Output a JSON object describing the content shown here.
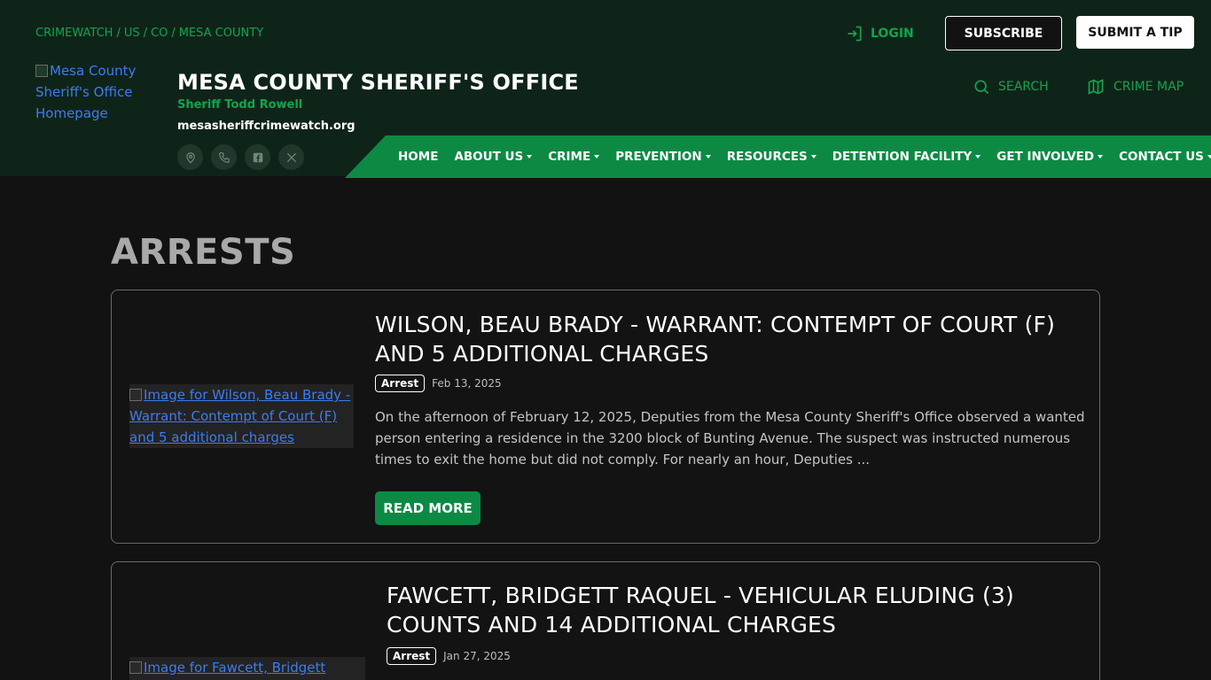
{
  "header": {
    "breadcrumb": [
      "CRIMEWATCH",
      "US",
      "CO",
      "MESA COUNTY"
    ],
    "logo_alt": "Mesa County Sheriff's Office Homepage",
    "agency_name": "MESA COUNTY SHERIFF'S OFFICE",
    "sheriff": "Sheriff Todd Rowell",
    "website": "mesasheriffcrimewatch.org",
    "login_label": "LOGIN",
    "subscribe_label": "SUBSCRIBE",
    "submit_tip_label": "SUBMIT A TIP",
    "search_label": "SEARCH",
    "crime_map_label": "CRIME MAP",
    "social_icons": [
      "location-icon",
      "phone-icon",
      "facebook-icon",
      "x-icon"
    ]
  },
  "nav": {
    "items": [
      {
        "label": "HOME",
        "dropdown": false
      },
      {
        "label": "ABOUT US",
        "dropdown": true
      },
      {
        "label": "CRIME",
        "dropdown": true
      },
      {
        "label": "PREVENTION",
        "dropdown": true
      },
      {
        "label": "RESOURCES",
        "dropdown": true
      },
      {
        "label": "DETENTION FACILITY",
        "dropdown": true
      },
      {
        "label": "GET INVOLVED",
        "dropdown": true
      },
      {
        "label": "CONTACT US",
        "dropdown": true
      }
    ]
  },
  "main": {
    "title": "ARRESTS",
    "posts": [
      {
        "image_alt": "Image for Wilson, Beau Brady - Warrant: Contempt of Court (F) and 5 additional charges",
        "title": "WILSON, BEAU BRADY - WARRANT: CONTEMPT OF COURT (F) AND 5 ADDITIONAL CHARGES",
        "badge": "Arrest",
        "date": "Feb 13, 2025",
        "excerpt": "On the afternoon of February 12, 2025, Deputies from the Mesa County Sheriff's Office observed a wanted person entering a residence in the 3200 block of Bunting Avenue. The suspect was instructed numerous times to exit the home but did not comply. For nearly an hour, Deputies ...",
        "read_more_label": "READ MORE"
      },
      {
        "image_alt": "Image for Fawcett, Bridgett Raquel",
        "title": "FAWCETT, BRIDGETT RAQUEL - VEHICULAR ELUDING (3) COUNTS AND 14 ADDITIONAL CHARGES",
        "badge": "Arrest",
        "date": "Jan 27, 2025"
      }
    ]
  },
  "colors": {
    "header_bg": "#0f2419",
    "accent_green": "#0c8a44",
    "link_green": "#14a34e",
    "page_bg": "#121212",
    "title_gray": "#a9a9a9"
  }
}
